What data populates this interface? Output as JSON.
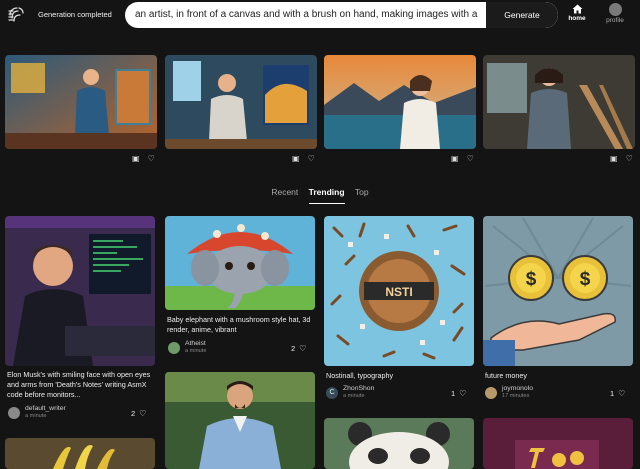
{
  "header": {
    "status": "Generation completed",
    "prompt_value": "an artist, in front of a canvas and with a brush on hand, making images with a",
    "generate_label": "Generate",
    "nav": [
      {
        "label": "home",
        "icon": "home-icon",
        "active": true
      },
      {
        "label": "profile",
        "icon": "avatar",
        "active": false
      }
    ]
  },
  "generated_images": [
    {
      "alt": "artist-painting-1",
      "icons": [
        "save-icon",
        "heart-icon"
      ]
    },
    {
      "alt": "artist-painting-2",
      "icons": [
        "save-icon",
        "heart-icon"
      ]
    },
    {
      "alt": "artist-painting-3",
      "icons": [
        "save-icon",
        "heart-icon"
      ]
    },
    {
      "alt": "artist-painting-4",
      "icons": [
        "save-icon",
        "heart-icon"
      ]
    }
  ],
  "tabs": [
    {
      "label": "Recent",
      "active": false
    },
    {
      "label": "Trending",
      "active": true
    },
    {
      "label": "Top",
      "active": false
    }
  ],
  "feed": [
    {
      "caption": "Elon Musk's with smiling face with open eyes and arms from 'Death's Notes' writing AsmX code before monitors...",
      "author": "default_writer",
      "time": "a minute",
      "likes": "2"
    },
    {
      "caption": "Baby elephant with a mushroom style hat, 3d render, anime, vibrant",
      "author": "Atheist",
      "time": "a minute",
      "likes": "2"
    },
    {
      "caption": "Nostinall, typography",
      "author": "ZhonShon",
      "author_initial": "C",
      "time": "a minute",
      "likes": "1"
    },
    {
      "caption": "future money",
      "author": "joymonolo",
      "time": "17 minutes",
      "likes": "1"
    }
  ],
  "colors": {
    "background": "#141414",
    "accent": "#ffffff"
  }
}
